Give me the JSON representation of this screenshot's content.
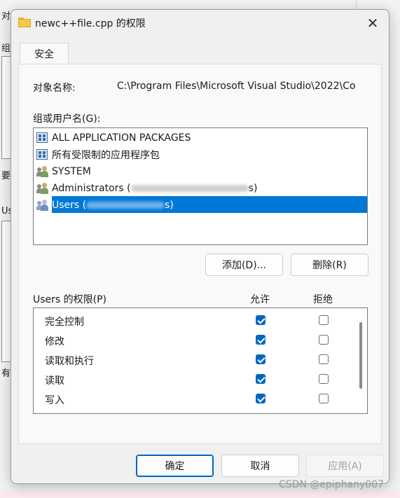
{
  "background": {
    "left_texts": [
      "对",
      "组",
      "要",
      "Us",
      "有"
    ]
  },
  "dialog": {
    "title": "newc++file.cpp 的权限",
    "close_glyph": "✕",
    "tab_label": "安全",
    "object_label": "对象名称:",
    "object_path": "C:\\Program Files\\Microsoft Visual Studio\\2022\\Co",
    "group_label": "组或用户名(G):",
    "users": [
      {
        "name": "ALL APPLICATION PACKAGES",
        "icon": "package-icon"
      },
      {
        "name": "所有受限制的应用程序包",
        "icon": "package-icon"
      },
      {
        "name": "SYSTEM",
        "icon": "users-icon"
      },
      {
        "name": "Administrators (",
        "suffix": "s)",
        "icon": "users-icon"
      },
      {
        "name": "Users (",
        "suffix": "s)",
        "icon": "users-icon",
        "selected": true
      }
    ],
    "add_button": "添加(D)...",
    "remove_button": "删除(R)",
    "perm_label": "Users 的权限(P)",
    "allow_header": "允许",
    "deny_header": "拒绝",
    "permissions": [
      {
        "name": "完全控制",
        "allow": true,
        "deny": false
      },
      {
        "name": "修改",
        "allow": true,
        "deny": false
      },
      {
        "name": "读取和执行",
        "allow": true,
        "deny": false
      },
      {
        "name": "读取",
        "allow": true,
        "deny": false
      },
      {
        "name": "写入",
        "allow": true,
        "deny": false
      }
    ],
    "ok_button": "确定",
    "cancel_button": "取消",
    "apply_button": "应用(A)"
  },
  "watermark": "CSDN @epiphany007",
  "colors": {
    "accent": "#0067c0",
    "selection": "#0078d7",
    "folder": "#f7c948"
  }
}
